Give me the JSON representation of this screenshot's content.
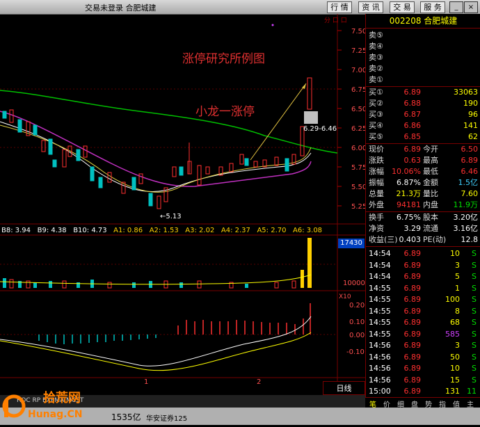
{
  "window": {
    "title": "交易未登录  合肥城建",
    "buttons": [
      "行 情",
      "资 讯",
      "交 易",
      "服 务"
    ],
    "win_controls": [
      "_",
      "□",
      "×"
    ]
  },
  "chart": {
    "annotation_title": "涨停研究所例图",
    "annotation_sub": "小龙一涨停",
    "top_right_mark": "分 口 口",
    "price_axis": [
      "7.50",
      "7.25",
      "7.00",
      "6.75",
      "6.50",
      "6.25",
      "6.00",
      "5.75",
      "5.50",
      "5.25"
    ],
    "low_label": "←5.13",
    "range_label": "6.29-6.46",
    "ma_legend": [
      "B8: 3.94",
      "B9: 4.38",
      "B10: 4.73",
      "A1: 0.86",
      "A2: 1.53",
      "A3: 2.02",
      "A4: 2.37",
      "A5: 2.70",
      "A6: 3.08"
    ],
    "volume_axis": [
      "17430",
      "10000",
      "X10"
    ],
    "macd_axis": [
      "0.20",
      "0.10",
      "0.00",
      "-0.10"
    ],
    "time_labels": [
      "1",
      "2"
    ],
    "indicator_tabs": "ROC  RP  EXPMA  MCST",
    "period_button": "日线"
  },
  "quote": {
    "code_name": "002208 合肥城建",
    "sell": [
      {
        "label": "卖⑤",
        "price": "",
        "vol": ""
      },
      {
        "label": "卖④",
        "price": "",
        "vol": ""
      },
      {
        "label": "卖③",
        "price": "",
        "vol": ""
      },
      {
        "label": "卖②",
        "price": "",
        "vol": ""
      },
      {
        "label": "卖①",
        "price": "",
        "vol": ""
      }
    ],
    "buy": [
      {
        "label": "买①",
        "price": "6.89",
        "vol": "33063"
      },
      {
        "label": "买②",
        "price": "6.88",
        "vol": "190"
      },
      {
        "label": "买③",
        "price": "6.87",
        "vol": "96"
      },
      {
        "label": "买④",
        "price": "6.86",
        "vol": "141"
      },
      {
        "label": "买⑤",
        "price": "6.85",
        "vol": "62"
      }
    ],
    "stats": [
      {
        "l1": "现价",
        "v1": "6.89",
        "l2": "今开",
        "v2": "6.50"
      },
      {
        "l1": "涨跌",
        "v1": "0.63",
        "l2": "最高",
        "v2": "6.89"
      },
      {
        "l1": "涨幅",
        "v1": "10.06%",
        "l2": "最低",
        "v2": "6.46"
      },
      {
        "l1": "振幅",
        "v1": "6.87%",
        "l2": "金额",
        "v2": "1.5亿"
      },
      {
        "l1": "总量",
        "v1": "21.3万",
        "l2": "量比",
        "v2": "7.60"
      },
      {
        "l1": "外盘",
        "v1": "94181",
        "l2": "内盘",
        "v2": "11.9万"
      },
      {
        "l1": "换手",
        "v1": "6.75%",
        "l2": "股本",
        "v2": "3.20亿"
      },
      {
        "l1": "净资",
        "v1": "3.29",
        "l2": "流通",
        "v2": "3.16亿"
      },
      {
        "l1": "收益(三)",
        "v1": "0.403",
        "l2": "PE(动)",
        "v2": "12.8"
      }
    ],
    "ticks": [
      {
        "t": "14:54",
        "p": "6.89",
        "v": "10",
        "s": "S"
      },
      {
        "t": "14:54",
        "p": "6.89",
        "v": "3",
        "s": "S"
      },
      {
        "t": "14:54",
        "p": "6.89",
        "v": "5",
        "s": "S"
      },
      {
        "t": "14:55",
        "p": "6.89",
        "v": "1",
        "s": "S"
      },
      {
        "t": "14:55",
        "p": "6.89",
        "v": "100",
        "s": "S"
      },
      {
        "t": "14:55",
        "p": "6.89",
        "v": "8",
        "s": "S"
      },
      {
        "t": "14:55",
        "p": "6.89",
        "v": "68",
        "s": "S"
      },
      {
        "t": "14:55",
        "p": "6.89",
        "v": "585",
        "s": "S"
      },
      {
        "t": "14:56",
        "p": "6.89",
        "v": "3",
        "s": "S"
      },
      {
        "t": "14:56",
        "p": "6.89",
        "v": "50",
        "s": "S"
      },
      {
        "t": "14:56",
        "p": "6.89",
        "v": "10",
        "s": "S"
      },
      {
        "t": "14:56",
        "p": "6.89",
        "v": "15",
        "s": "S"
      },
      {
        "t": "15:00",
        "p": "6.89",
        "v": "131",
        "s": "11"
      }
    ],
    "tabs": [
      "笔",
      "价",
      "细",
      "盘",
      "势",
      "指",
      "值",
      "主"
    ]
  },
  "status": {
    "item1": "1535亿",
    "item2": "华安证券125",
    "watermark": "拾荒网",
    "watermark_url": "Hunag.CN"
  }
}
